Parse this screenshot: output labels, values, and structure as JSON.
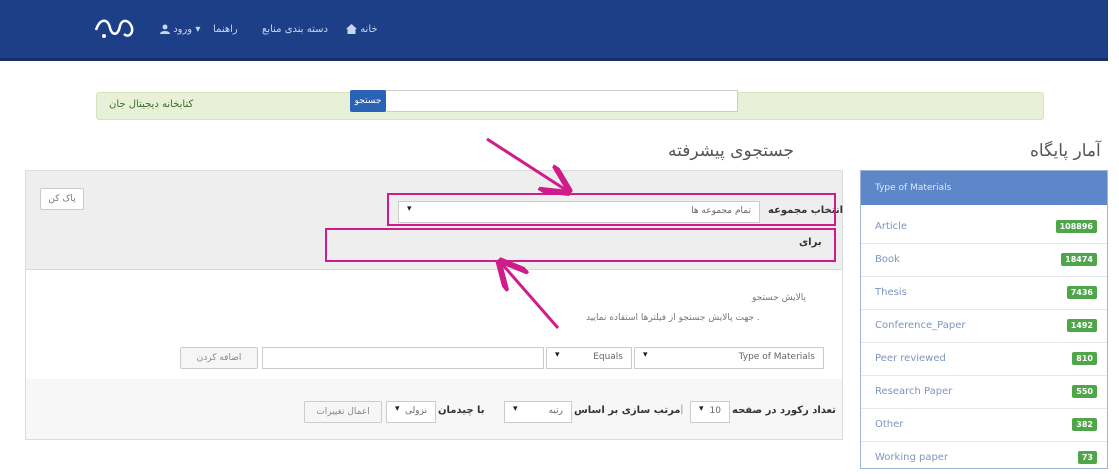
{
  "navbar": {
    "logo_icon": "logo-icon",
    "items": [
      {
        "label": "ورود",
        "icon": "user-icon"
      },
      {
        "label": "راهنما"
      },
      {
        "label": "دسته بندی منابع"
      },
      {
        "label": "خانه",
        "icon": "home-icon"
      }
    ],
    "background": "#1d3f87"
  },
  "breadcrumb": {
    "label": "کتابخانه دیجیتال جان"
  },
  "advanced_search": {
    "title": "جستجوی پیشرفته",
    "clear_label": "پاک کن",
    "collection_label": "انتخاب مجموعه",
    "collection_value": "تمام مجموعه ها",
    "for_label": "برای",
    "search_value": "",
    "search_button": "جستجو",
    "filters_title": "پالایش جستجو",
    "filters_help": "جهت پالایش جستجو از فیلترها استفاده نمایید .",
    "filter_field": "Type of Materials",
    "filter_op": "Equals",
    "filter_value": "",
    "add_button": "اضافه کردن",
    "per_page_label": "تعداد رکورد در صفحه",
    "per_page_value": "10",
    "sort_label": "مرتب سازی بر اساس",
    "sort_value": "رتبه",
    "order_label": "با چیدمان",
    "order_value": "نزولی",
    "apply_button": "اعمال تغییرات"
  },
  "stats": {
    "title": "آمار پایگاه",
    "header": "Type of Materials",
    "rows": [
      {
        "label": "Article",
        "count": "108896"
      },
      {
        "label": "Book",
        "count": "18474"
      },
      {
        "label": "Thesis",
        "count": "7436"
      },
      {
        "label": "Conference_Paper",
        "count": "1492"
      },
      {
        "label": "Peer reviewed",
        "count": "810"
      },
      {
        "label": "Research Paper",
        "count": "550"
      },
      {
        "label": "Other",
        "count": "382"
      },
      {
        "label": "Working paper",
        "count": "73"
      }
    ],
    "badge_color": "#4ea54a"
  },
  "annotation_color": "#d01c8b"
}
